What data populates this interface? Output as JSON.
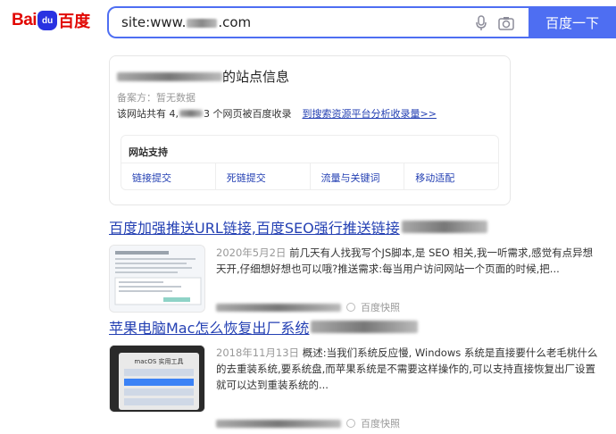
{
  "header": {
    "logo_bai": "Bai",
    "logo_du": "du",
    "logo_cn": "百度",
    "query_prefix": "site:www.",
    "query_suffix": ".com",
    "search_button": "百度一下"
  },
  "site_card": {
    "title_suffix": "的站点信息",
    "beian": "备案方：暂无数据",
    "indexed_prefix": "该网站共有 4,",
    "indexed_suffix": "3 个网页被百度收录",
    "indexed_link": "到搜索资源平台分析收录量>>",
    "support_title": "网站支持",
    "support_links": [
      "链接提交",
      "死链提交",
      "流量与关键词",
      "移动适配"
    ]
  },
  "results": [
    {
      "title": "百度加强推送URL链接,百度SEO强行推送链接",
      "date": "2020年5月2日",
      "snippet": "前几天有人找我写个JS脚本,是  SEO  相关,我一听需求,感觉有点异想天开,仔细想好想也可以哦?推送需求:每当用户访问网站一个页面的时候,把...",
      "cache": "百度快照"
    },
    {
      "title": "苹果电脑Mac怎么恢复出厂系统",
      "date": "2018年11月13日",
      "snippet": "概述:当我们系统反应慢, Windows 系统是直接要什么老毛桃什么的去重装系统,要系统盘,而苹果系统是不需要这样操作的,可以支持直接恢复出厂设置就可以达到重装系统的...",
      "cache": "百度快照",
      "thumb_caption": "macOS 实用工具"
    }
  ],
  "colors": {
    "accent": "#4e6ef2",
    "link": "#2440b3",
    "brand_red": "#e10601"
  }
}
